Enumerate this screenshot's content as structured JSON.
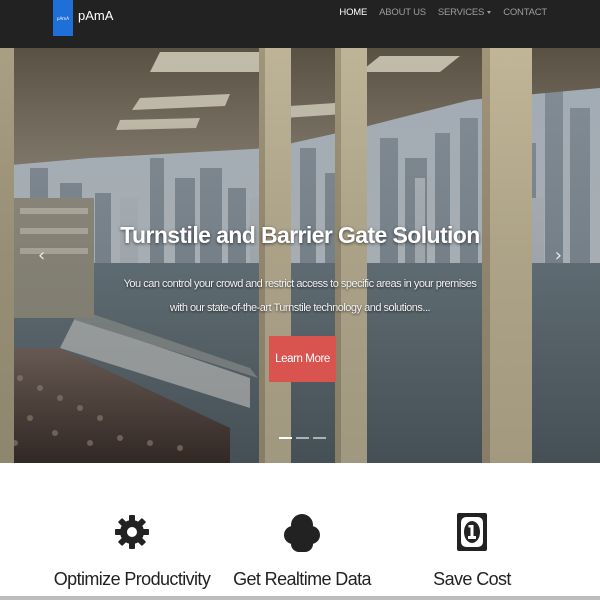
{
  "navbar": {
    "logo_text": "pAmA",
    "brand": "pAmA",
    "links": [
      {
        "label": "HOME",
        "active": true
      },
      {
        "label": "ABOUT US",
        "active": false
      },
      {
        "label": "SERVICES",
        "active": false,
        "dropdown": true
      },
      {
        "label": "CONTACT",
        "active": false
      }
    ]
  },
  "hero": {
    "title": "Turnstile and Barrier Gate Solution",
    "text": "You can control your crowd and restrict access to specific areas in your premises with our state-of-the-art Turnstile technology and solutions...",
    "button_label": "Learn More",
    "prev_arrow": "‹",
    "next_arrow": "›",
    "slides": 3,
    "active_slide": 1
  },
  "features": [
    {
      "title": "Optimize Productivity",
      "icon": "gear-icon"
    },
    {
      "title": "Get Realtime Data",
      "icon": "cloud-icon"
    },
    {
      "title": "Save Cost",
      "icon": "money-bill-icon"
    }
  ],
  "colors": {
    "navbar_bg": "#222222",
    "accent_button": "#d9534f",
    "logo_bg": "#1f6fd8"
  }
}
